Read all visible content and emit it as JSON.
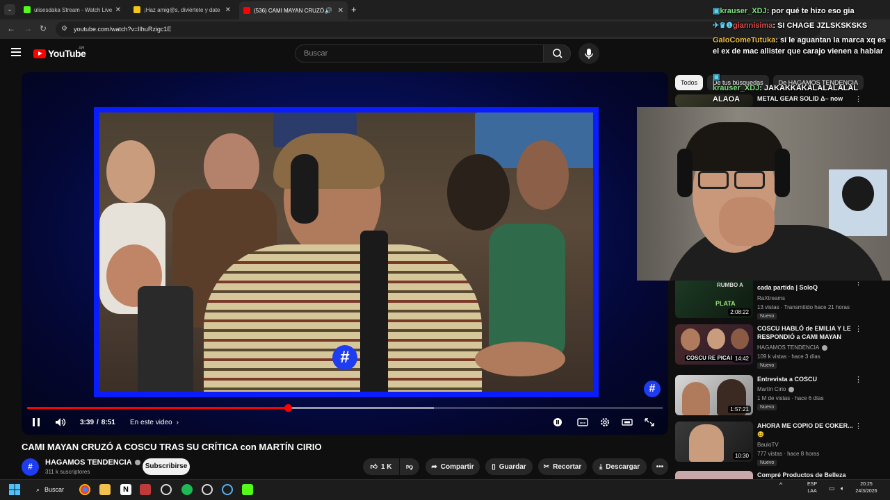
{
  "browser": {
    "tabs": [
      {
        "title": "ulisesdaka Stream - Watch Live",
        "favicon_color": "#53fc18"
      },
      {
        "title": "¡Haz amig@s, diviértete y date",
        "favicon_color": "#f5c518"
      },
      {
        "title": "(536) CAMI MAYAN CRUZÓ",
        "favicon_color": "#ff0000"
      }
    ],
    "url": "youtube.com/watch?v=lIhuRzigc1E"
  },
  "youtube": {
    "logo_text": "YouTube",
    "country": "AR",
    "search_placeholder": "Buscar"
  },
  "player": {
    "time_current": "3:39",
    "time_total": "8:51",
    "chapter_label": "En este video",
    "progress_played_fraction": 0.41,
    "progress_loaded_fraction": 0.64,
    "overlay_logo": "#"
  },
  "video": {
    "title": "CAMI MAYAN CRUZÓ A COSCU TRAS SU CRÍTICA con MARTÍN CIRIO",
    "channel_name": "HAGAMOS TENDENCIA",
    "subscribers": "311 k suscriptores",
    "subscribe_label": "Subscribirse",
    "likes": "1 K",
    "share_label": "Compartir",
    "save_label": "Guardar",
    "clip_label": "Recortar",
    "download_label": "Descargar"
  },
  "sidebar": {
    "chips": [
      "Todos",
      "De tus búsquedas",
      "De HAGAMOS TENDENCIA"
    ],
    "recs": [
      {
        "title": "METAL GEAR SOLID Δ– now",
        "channel": "",
        "meta": "",
        "duration": "",
        "new": false
      },
      {
        "title": "cada partida | SoloQ",
        "channel": "RaXtreams",
        "meta": "13 vistas · Transmitido hace 21 horas",
        "duration": "2:08:22",
        "new": true,
        "badge": "Nuevo"
      },
      {
        "title": "COSCU HABLÓ de EMILIA Y LE RESPONDIÓ a CAMI MAYAN",
        "channel": "HAGAMOS TENDENCIA",
        "meta": "109 k vistas · hace 3 días",
        "duration": "14:42",
        "new": true,
        "badge": "Nuevo",
        "thumb_text": "COSCU RE PICAI"
      },
      {
        "title": "Entrevista a COSCU",
        "channel": "Martín Cirio",
        "meta": "1 M de vistas · hace 6 días",
        "duration": "1:57:21",
        "new": true,
        "badge": "Nuevo"
      },
      {
        "title": "AHORA ME COPIO DE COKER...",
        "channel": "BauloTV",
        "meta": "777 vistas · hace 8 horas",
        "duration": "10:30",
        "new": true,
        "badge": "Nuevo",
        "emoji": "😆"
      },
      {
        "title": "Compré Productos de Belleza",
        "channel": "",
        "meta": "",
        "duration": "",
        "new": false
      }
    ]
  },
  "chat": [
    {
      "user": "krauser_XDJ",
      "user_color": "#7ee07e",
      "message": "por qué te hizo eso gia"
    },
    {
      "user": "giannisima",
      "user_color": "#e05050",
      "message": "SI CHAGE JZLSKSKSKS"
    },
    {
      "user": "GaloComeTutuka",
      "user_color": "#f0c040",
      "message": "si le aguantan la marca xq es el ex de mac allister que carajo vienen a hablar"
    },
    {
      "user": "krauser_XDJ",
      "user_color": "#7ee07e",
      "message": "JAKAKKAKALALALALAL ALAOA"
    }
  ],
  "taskbar": {
    "search_label": "Buscar",
    "lang_top": "ESP",
    "lang_bottom": "LAA",
    "time": "20:25",
    "date": "24/3/2026"
  }
}
